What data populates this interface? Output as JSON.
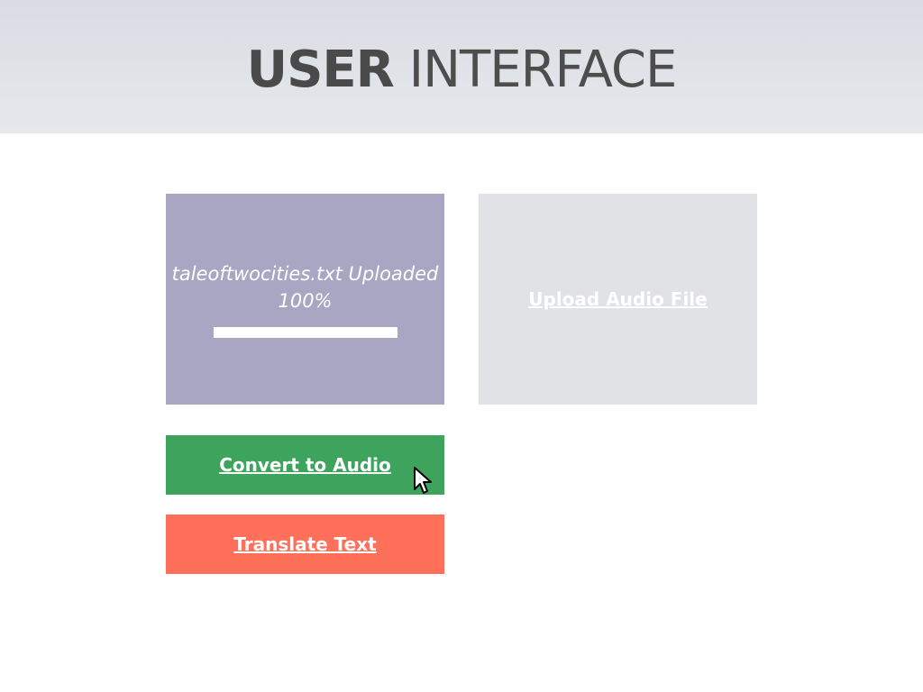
{
  "header": {
    "title_bold": "USER",
    "title_light": "INTERFACE"
  },
  "upload_text": {
    "status": "taleoftwocities.txt Uploaded 100%",
    "progress": 1.0
  },
  "upload_audio": {
    "label": "Upload Audio File"
  },
  "actions": {
    "convert_label": "Convert to Audio",
    "translate_label": "Translate Text"
  },
  "colors": {
    "upload_tile": "#a8a6c3",
    "audio_tile": "#e0e2e6",
    "convert": "#3ea45d",
    "translate": "#ff705b"
  },
  "icons": {
    "cursor": "mouse-pointer-icon"
  }
}
